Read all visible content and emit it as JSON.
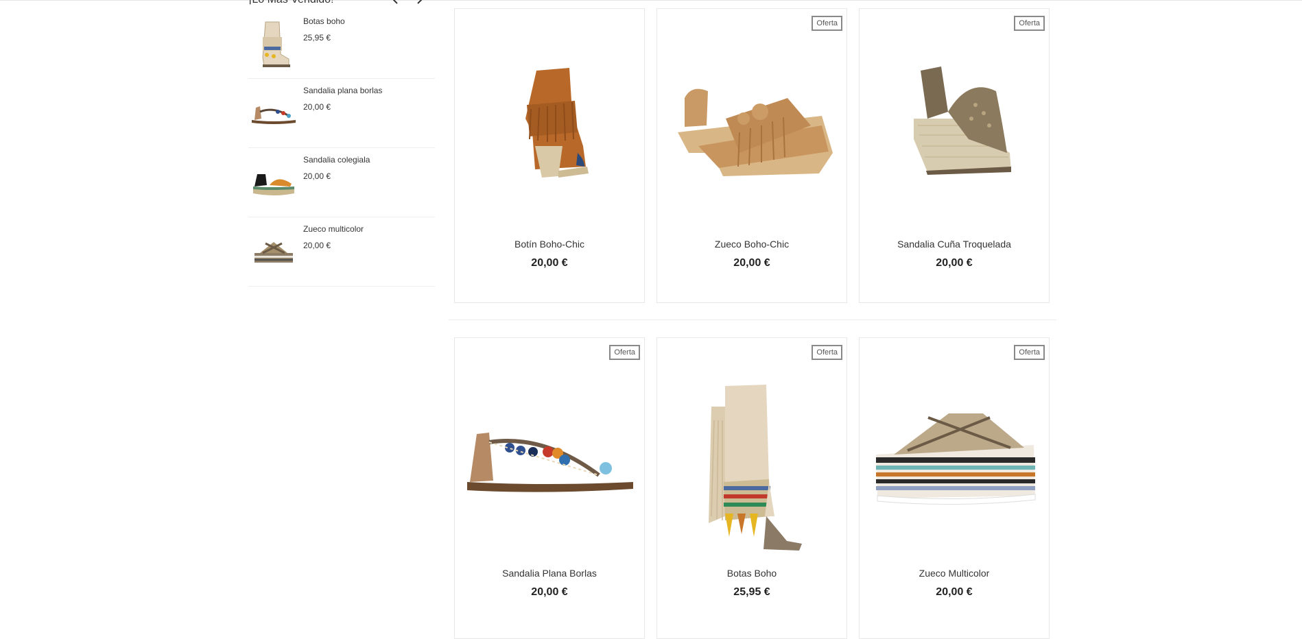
{
  "sidebar": {
    "title": "¡Lo Más Vendido!",
    "items": [
      {
        "name": "Botas boho",
        "price": "25,95 €",
        "icon": "boho-boot-thumbnail"
      },
      {
        "name": "Sandalia plana borlas",
        "price": "20,00 €",
        "icon": "flat-sandal-thumbnail"
      },
      {
        "name": "Sandalia colegiala",
        "price": "20,00 €",
        "icon": "colegiala-sandal-thumbnail"
      },
      {
        "name": "Zueco multicolor",
        "price": "20,00 €",
        "icon": "multicolor-clog-thumbnail"
      }
    ]
  },
  "products": [
    {
      "title": "Botín Boho-Chic",
      "price": "20,00 €",
      "badge": ""
    },
    {
      "title": "Zueco Boho-Chic",
      "price": "20,00 €",
      "badge": "Oferta"
    },
    {
      "title": "Sandalia Cuña Troquelada",
      "price": "20,00 €",
      "badge": "Oferta"
    },
    {
      "title": "Sandalia Plana Borlas",
      "price": "20,00 €",
      "badge": "Oferta"
    },
    {
      "title": "Botas Boho",
      "price": "25,95 €",
      "badge": "Oferta"
    },
    {
      "title": "Zueco Multicolor",
      "price": "20,00 €",
      "badge": "Oferta"
    }
  ],
  "colors": {
    "suede": "#b8692a",
    "tan": "#c9955e",
    "jute": "#d8ccb0",
    "badge_border": "#888888"
  }
}
